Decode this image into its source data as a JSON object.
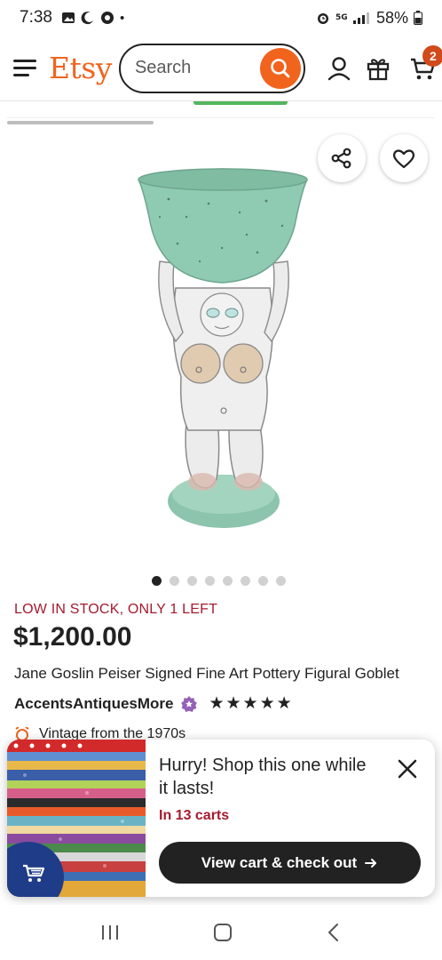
{
  "status_bar": {
    "time": "7:38",
    "battery": "58%"
  },
  "header": {
    "logo": "Etsy",
    "search_placeholder": "Search",
    "cart_count": "2"
  },
  "gallery": {
    "image_count": 8,
    "active_index": 0
  },
  "listing": {
    "stock_notice": "LOW IN STOCK, ONLY 1 LEFT",
    "price": "$1,200.00",
    "title": "Jane Goslin Peiser Signed Fine Art Pottery Figural Goblet",
    "shop_name": "AccentsAntiquesMore",
    "rating_stars": "★★★★★",
    "vintage_note": "Vintage from the 1970s"
  },
  "popup": {
    "title": "Hurry! Shop this one while it lasts!",
    "carts_note": "In 13 carts",
    "cta_label": "View cart & check out"
  },
  "colors": {
    "brand_orange": "#f1641e",
    "alert_red": "#a61a2e",
    "cta_dark": "#222222"
  }
}
